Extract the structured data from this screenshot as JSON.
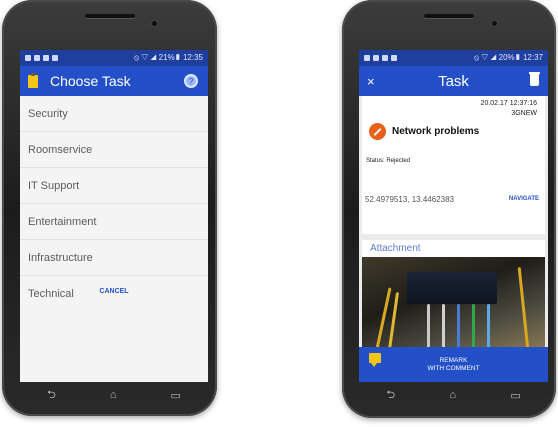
{
  "left_phone": {
    "status_bar": {
      "right": "⦸ ▽ ◢ 21%▮ 12:35"
    },
    "app_bar": {
      "title": "Choose Task"
    },
    "task_options": [
      "Security",
      "Roomservice",
      "IT Support",
      "Entertainment",
      "Infrastructure",
      "Technical"
    ],
    "cancel_label": "CANCEL"
  },
  "right_phone": {
    "status_bar": {
      "right": "⦸ ▽ ◢ 20%▮ 12:37"
    },
    "app_bar": {
      "close_label": "×",
      "title": "Task"
    },
    "task": {
      "datetime": "20.02.17 12:37:16",
      "code": "3GNEW",
      "title": "Network problems",
      "status": "Status: Rejected",
      "coordinates": "52.4979513, 13.4462383",
      "navigate_label": "NAVIGATE",
      "attachment_label": "Attachment"
    },
    "remark_label_line1": "REMARK",
    "remark_label_line2": "WITH COMMENT"
  },
  "nav_keys": {
    "back": "⮌",
    "home": "⌂",
    "recents": "▭"
  },
  "colors": {
    "status_bar": "#1e3f9e",
    "app_bar": "#2350c8",
    "accent_icon": "#f5c518",
    "alert_icon": "#e8611a",
    "link": "#2350c8"
  },
  "icons": {
    "left_app_bar": [
      "clipboard-icon",
      "help-icon"
    ],
    "right_app_bar": [
      "close-icon",
      "trash-icon"
    ],
    "task": [
      "network-problem-icon",
      "comment-icon"
    ]
  }
}
